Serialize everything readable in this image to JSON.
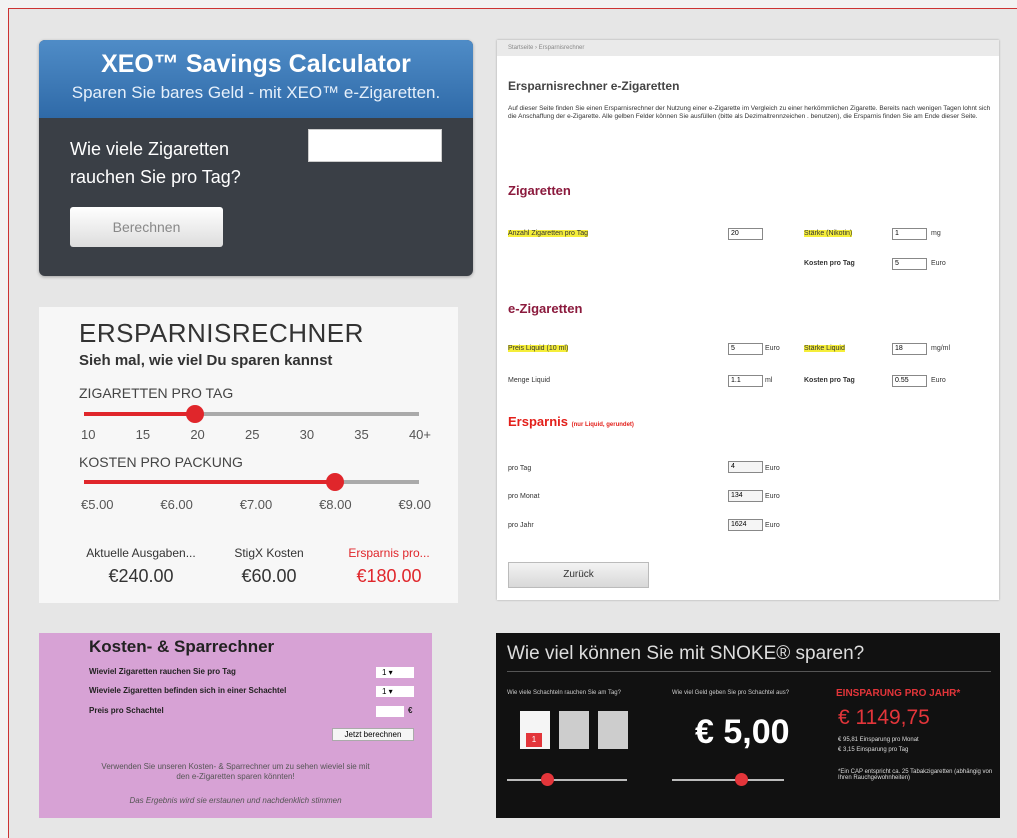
{
  "xeo": {
    "title": "XEO™ Savings Calculator",
    "subtitle": "Sparen Sie bares Geld - mit XEO™ e-Zigaretten.",
    "question": "Wie viele Zigaretten rauchen Sie pro Tag?",
    "button": "Berechnen"
  },
  "ers": {
    "title": "ERSPARNISRECHNER",
    "subtitle": "Sieh mal, wie viel Du sparen kannst",
    "label1": "ZIGARETTEN PRO TAG",
    "ticks1": [
      "10",
      "15",
      "20",
      "25",
      "30",
      "35",
      "40+"
    ],
    "slider1": 0.33,
    "label2": "KOSTEN PRO PACKUNG",
    "ticks2": [
      "€5.00",
      "€6.00",
      "€7.00",
      "€8.00",
      "€9.00"
    ],
    "slider2": 0.75,
    "cols": [
      {
        "head": "Aktuelle Ausgaben...",
        "val": "€240.00"
      },
      {
        "head": "StigX Kosten",
        "val": "€60.00"
      },
      {
        "head": "Ersparnis pro...",
        "val": "€180.00"
      }
    ]
  },
  "pink": {
    "title": "Kosten- & Sparrechner",
    "r1": "Wieviel Zigaretten rauchen Sie pro Tag",
    "r2": "Wieviele Zigaretten befinden sich in einer Schachtel",
    "r3": "Preis pro Schachtel",
    "s1": "1",
    "s2": "1",
    "euro": "€",
    "calc": "Jetzt berechnen",
    "f1": "Verwenden Sie unseren Kosten- & Sparrechner um zu sehen wieviel sie mit",
    "f2": "den e-Zigaretten sparen könnten!",
    "f3": "Das Ergebnis wird sie erstaunen und nachdenklich stimmen"
  },
  "snoke": {
    "title": "Wie viel können Sie mit SNOKE® sparen?",
    "q1": "Wie viele Schachteln rauchen Sie am Tag?",
    "q2": "Wie viel Geld geben Sie pro Schachtel aus?",
    "value": "€ 5,00",
    "savTitle": "EINSPARUNG PRO JAHR*",
    "savVal": "€ 1149,75",
    "n1": "€ 95,81 Einsparung pro Monat",
    "n2": "€ 3,15 Einsparung pro Tag",
    "n3": "*Ein CAP entspricht ca. 25 Tabakzigaretten (abhängig von Ihren Rauchgewohnheiten)",
    "pack": "1"
  },
  "page": {
    "breadcrumb": "Startseite › Ersparnisrechner",
    "h1": "Ersparnisrechner e-Zigaretten",
    "intro": "Auf dieser Seite finden Sie einen Ersparnisrechner der Nutzung einer e-Zigarette im Vergleich zu einer herkömmlichen Zigarette. Bereits nach wenigen Tagen lohnt sich die Anschaffung der e-Zigarette. Alle gelben Felder können Sie ausfüllen (bitte als Dezimaltrennzeichen . benutzen), die Ersparnis finden Sie am Ende dieser Seite.",
    "sec1": "Zigaretten",
    "a1": "Anzahl Zigaretten pro Tag",
    "v1": "20",
    "a2": "Stärke (Nikotin)",
    "v2": "1",
    "u2": "mg",
    "a3": "Kosten pro Tag",
    "v3": "5",
    "u3": "Euro",
    "sec2": "e-Zigaretten",
    "b1": "Preis Liquid (10 ml)",
    "w1": "5",
    "x1": "Euro",
    "b2": "Stärke Liquid",
    "w2": "18",
    "x2": "mg/ml",
    "b3": "Menge Liquid",
    "w3": "1.1",
    "x3": "ml",
    "b4": "Kosten pro Tag",
    "w4": "0.55",
    "x4": "Euro",
    "sec3": "Ersparnis",
    "sec3s": "(nur Liquid, gerundet)",
    "c1": "pro Tag",
    "y1": "4",
    "c2": "pro Monat",
    "y2": "134",
    "c3": "pro Jahr",
    "y3": "1624",
    "eu": "Euro",
    "back": "Zurück"
  }
}
